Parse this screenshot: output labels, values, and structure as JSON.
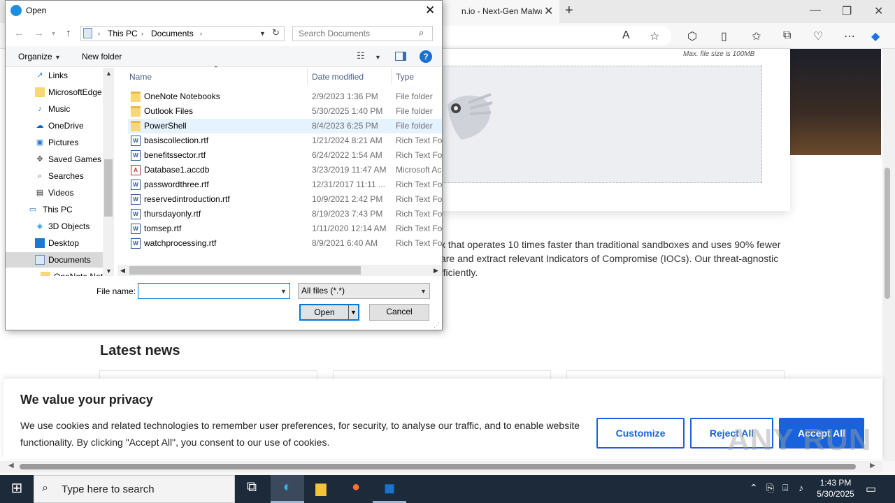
{
  "browser": {
    "tab_title": "n.io - Next-Gen Malware A",
    "upload": {
      "max_size": "Max. file size is 100MB"
    },
    "paragraph": "x that operates 10 times faster than traditional sandboxes and uses 90% fewer are and extract relevant Indicators of Compromise (IOCs). Our threat-agnostic fficiently.",
    "latest_news": "Latest news"
  },
  "cookie": {
    "title": "We value your privacy",
    "text": "We use cookies and related technologies to remember user preferences, for security, to analyse our traffic, and to enable website functionality. By clicking \"Accept All\", you consent to our use of cookies.",
    "customize": "Customize",
    "reject": "Reject All",
    "accept": "Accept All",
    "brand_color": "#1863dc"
  },
  "watermark": "ANY RUN",
  "taskbar": {
    "search_placeholder": "Type here to search",
    "time": "1:43 PM",
    "date": "5/30/2025"
  },
  "dialog": {
    "title": "Open",
    "path": [
      "This PC",
      "Documents"
    ],
    "search_placeholder": "Search Documents",
    "organize": "Organize",
    "new_folder": "New folder",
    "nav_items": [
      {
        "label": "Links",
        "icon": "links-icon"
      },
      {
        "label": "MicrosoftEdge",
        "icon": "folder-icon"
      },
      {
        "label": "Music",
        "icon": "music-icon"
      },
      {
        "label": "OneDrive",
        "icon": "cloud-icon"
      },
      {
        "label": "Pictures",
        "icon": "pictures-icon"
      },
      {
        "label": "Saved Games",
        "icon": "games-icon"
      },
      {
        "label": "Searches",
        "icon": "search-icon"
      },
      {
        "label": "Videos",
        "icon": "videos-icon"
      },
      {
        "label": "This PC",
        "icon": "computer-icon"
      },
      {
        "label": "3D Objects",
        "icon": "cube-icon"
      },
      {
        "label": "Desktop",
        "icon": "desktop-icon"
      },
      {
        "label": "Documents",
        "icon": "documents-icon"
      },
      {
        "label": "OneNote Not",
        "icon": "folder-icon"
      }
    ],
    "columns": {
      "name": "Name",
      "date": "Date modified",
      "type": "Type"
    },
    "files": [
      {
        "name": "OneNote Notebooks",
        "date": "2/9/2023 1:36 PM",
        "type": "File folder",
        "kind": "folder"
      },
      {
        "name": "Outlook Files",
        "date": "5/30/2025 1:40 PM",
        "type": "File folder",
        "kind": "folder"
      },
      {
        "name": "PowerShell",
        "date": "8/4/2023 6:25 PM",
        "type": "File folder",
        "kind": "folder"
      },
      {
        "name": "basiscollection.rtf",
        "date": "1/21/2024 8:21 AM",
        "type": "Rich Text Format",
        "kind": "doc"
      },
      {
        "name": "benefitssector.rtf",
        "date": "6/24/2022 1:54 AM",
        "type": "Rich Text Format",
        "kind": "doc"
      },
      {
        "name": "Database1.accdb",
        "date": "3/23/2019 11:47 AM",
        "type": "Microsoft Access",
        "kind": "access"
      },
      {
        "name": "passwordthree.rtf",
        "date": "12/31/2017 11:11 ...",
        "type": "Rich Text Format",
        "kind": "doc"
      },
      {
        "name": "reservedintroduction.rtf",
        "date": "10/9/2021 2:42 PM",
        "type": "Rich Text Format",
        "kind": "doc"
      },
      {
        "name": "thursdayonly.rtf",
        "date": "8/19/2023 7:43 PM",
        "type": "Rich Text Format",
        "kind": "doc"
      },
      {
        "name": "tomsep.rtf",
        "date": "1/11/2020 12:14 AM",
        "type": "Rich Text Format",
        "kind": "doc"
      },
      {
        "name": "watchprocessing.rtf",
        "date": "8/9/2021 6:40 AM",
        "type": "Rich Text Format",
        "kind": "doc"
      }
    ],
    "file_name_label": "File name:",
    "file_name_value": "",
    "filter": "All files (*.*)",
    "open": "Open",
    "cancel": "Cancel"
  }
}
